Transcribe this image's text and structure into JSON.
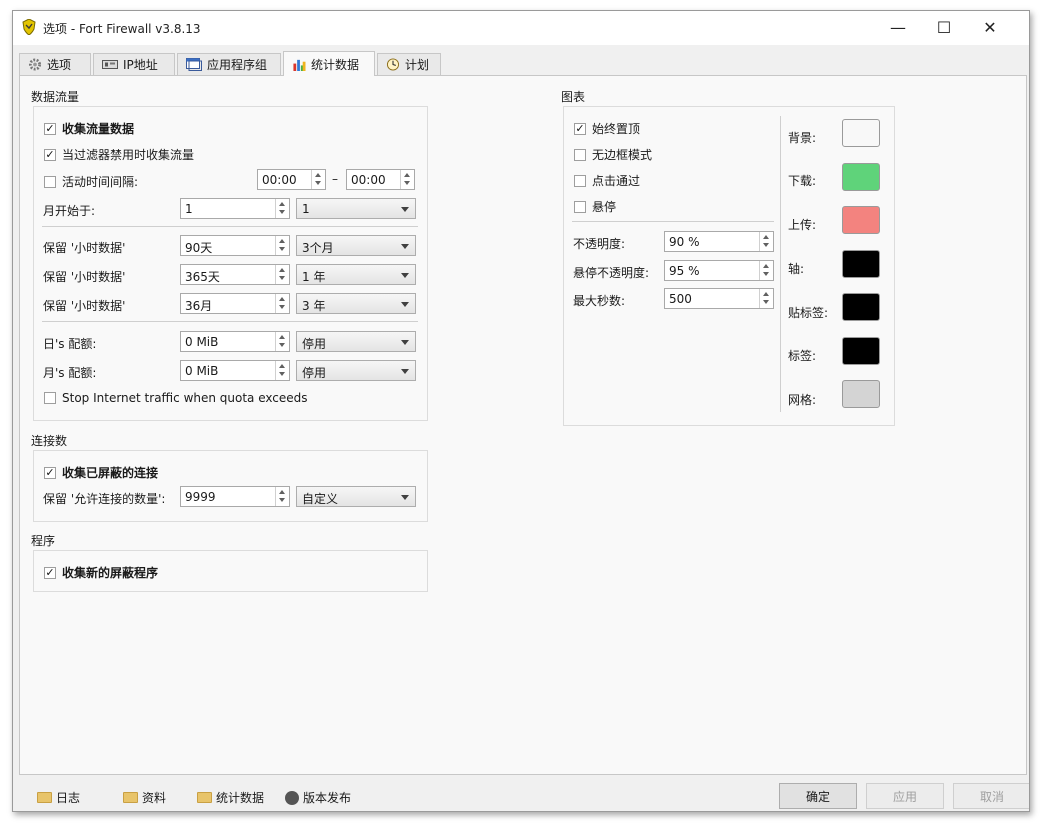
{
  "window": {
    "title": "选项 - Fort Firewall v3.8.13",
    "minimize": "—",
    "maximize": "☐",
    "close": "✕"
  },
  "tabs": [
    {
      "label": "选项",
      "icon": "gear-icon"
    },
    {
      "label": "IP地址",
      "icon": "network-card-icon"
    },
    {
      "label": "应用程序组",
      "icon": "window-icon"
    },
    {
      "label": "统计数据",
      "icon": "bar-chart-icon",
      "active": true
    },
    {
      "label": "计划",
      "icon": "clock-icon"
    }
  ],
  "traffic": {
    "title": "数据流量",
    "collect_traffic": "收集流量数据",
    "collect_when_disabled": "当过滤器禁用时收集流量",
    "active_period": "活动时间间隔:",
    "period_from": "00:00",
    "period_dash": "–",
    "period_to": "00:00",
    "month_start_label": "月开始于:",
    "month_start_value": "1",
    "month_start_combo": "1",
    "keep_hourly_label": "保留 '小时数据'",
    "keep_hourly_value": "90天",
    "keep_hourly_combo": "3个月",
    "keep_daily_label": "保留 '小时数据'",
    "keep_daily_value": "365天",
    "keep_daily_combo": "1 年",
    "keep_monthly_label": "保留 '小时数据'",
    "keep_monthly_value": "36月",
    "keep_monthly_combo": "3 年",
    "quota_day_label": "日's 配额:",
    "quota_day_value": "0 MiB",
    "quota_day_combo": "停用",
    "quota_month_label": "月's 配额:",
    "quota_month_value": "0 MiB",
    "quota_month_combo": "停用",
    "stop_internet": "Stop Internet traffic when quota exceeds"
  },
  "connections": {
    "title": "连接数",
    "collect_blocked": "收集已屏蔽的连接",
    "keep_label": "保留 '允许连接的数量':",
    "keep_value": "9999",
    "keep_combo": "自定义"
  },
  "programs": {
    "title": "程序",
    "collect_new_blocked": "收集新的屏蔽程序"
  },
  "graph": {
    "title": "图表",
    "always_on_top": "始终置顶",
    "frameless": "无边框模式",
    "click_through": "点击通过",
    "hide_on_hover": "悬停",
    "opacity_label": "不透明度:",
    "opacity_value": "90 %",
    "hover_opacity_label": "悬停不透明度:",
    "hover_opacity_value": "95 %",
    "max_seconds_label": "最大秒数:",
    "max_seconds_value": "500",
    "colors": [
      {
        "label": "背景:",
        "color": "#f8f8f8"
      },
      {
        "label": "下载:",
        "color": "#5fd37a"
      },
      {
        "label": "上传:",
        "color": "#f3837f"
      },
      {
        "label": "轴:",
        "color": "#000000"
      },
      {
        "label": "贴标签:",
        "color": "#000000"
      },
      {
        "label": "标签:",
        "color": "#000000"
      },
      {
        "label": "网格:",
        "color": "#d4d4d4"
      }
    ]
  },
  "footer": {
    "links": [
      "日志",
      "资料",
      "统计数据",
      "版本发布"
    ],
    "ok": "确定",
    "apply": "应用",
    "cancel": "取消"
  }
}
